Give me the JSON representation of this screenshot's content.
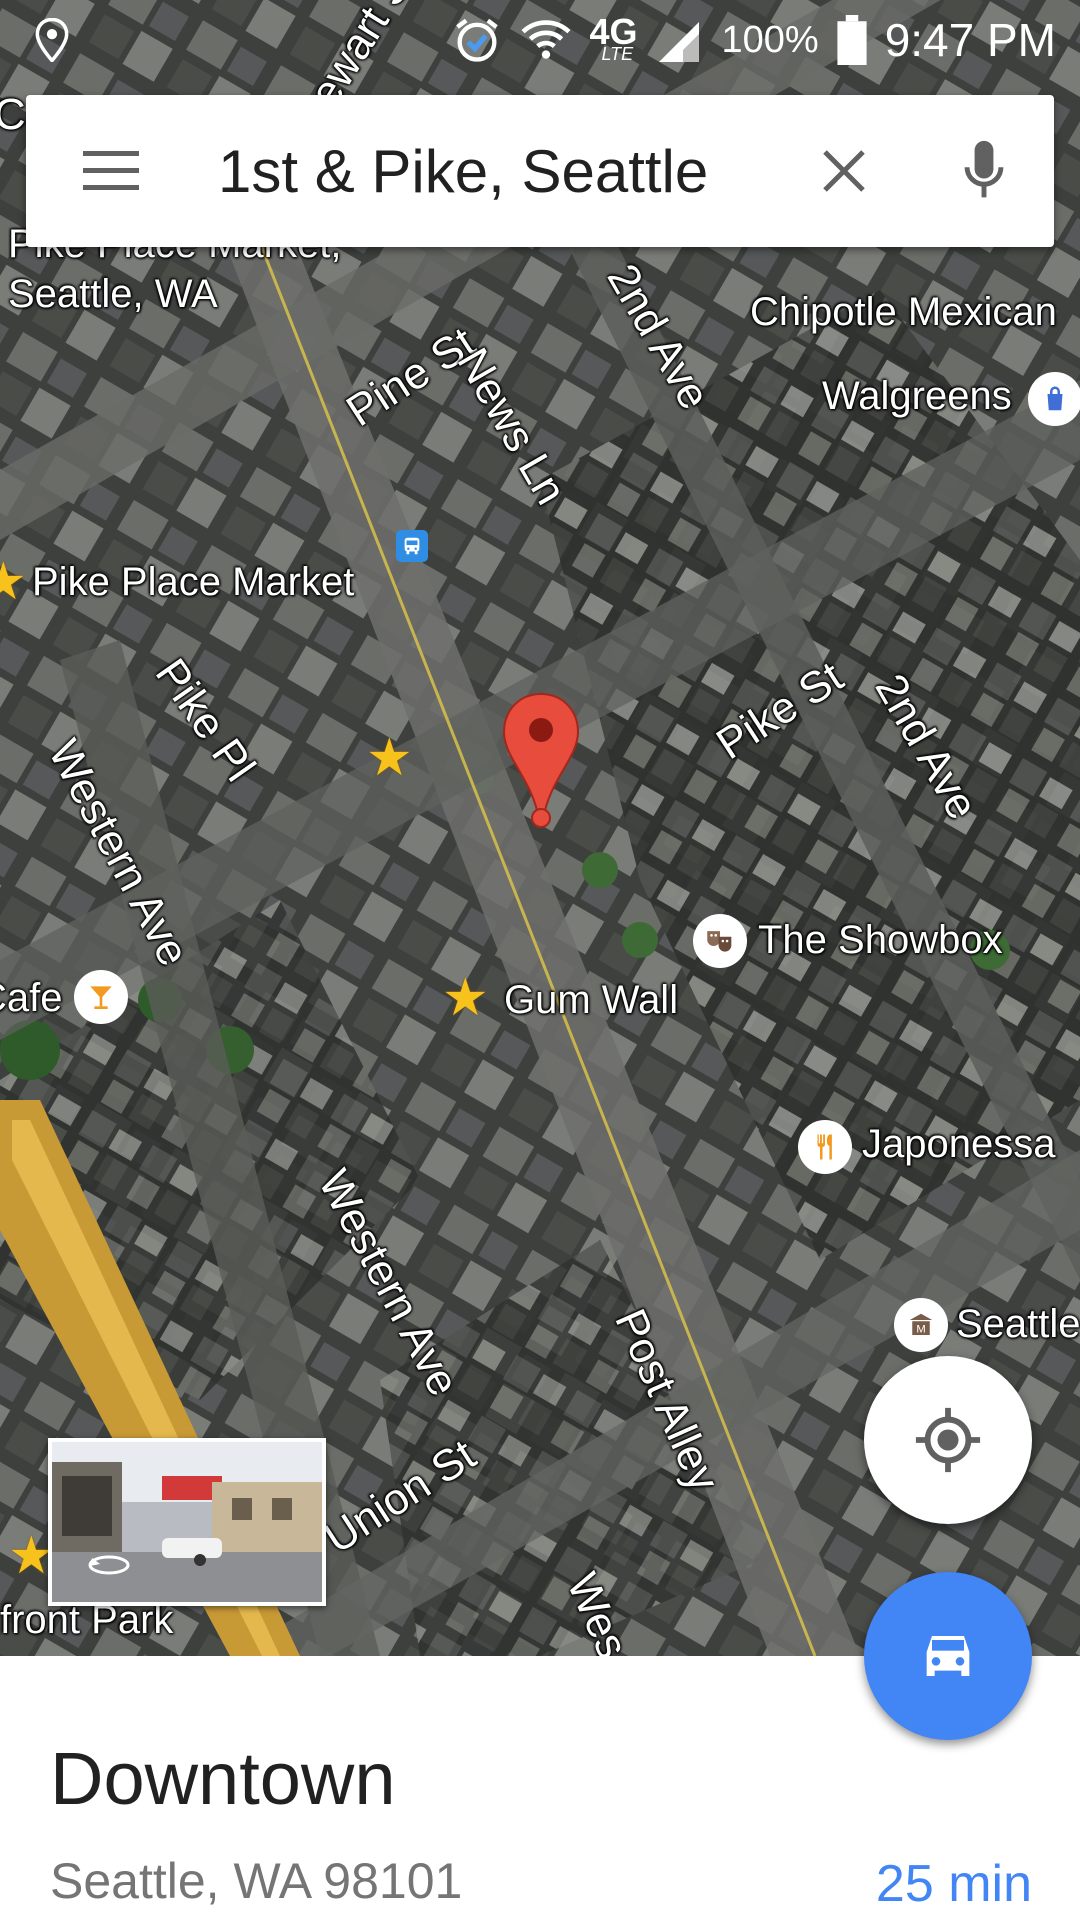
{
  "status_bar": {
    "battery": "100%",
    "time": "9:47 PM",
    "network": "4G",
    "network_sub": "LTE",
    "icons": [
      "location-icon",
      "alarm-icon",
      "wifi-icon",
      "signal-icon",
      "battery-icon"
    ]
  },
  "search": {
    "query": "1st & Pike, Seattle",
    "menu_icon": "hamburger-menu-icon",
    "clear_icon": "close-icon",
    "voice_icon": "microphone-icon"
  },
  "map": {
    "view": "satellite",
    "streets": {
      "pine": "Pine St",
      "news": "News Ln",
      "second_ave_top": "2nd Ave",
      "pike_st": "Pike St",
      "second_ave_right": "2nd Ave",
      "pike_pl": "Pike Pl",
      "western_ave_left": "Western Ave",
      "western_ave_mid": "Western Ave",
      "post_alley": "Post Alley",
      "union_st": "Union St",
      "west_bottom": "Wes",
      "partial_top": "ewart S",
      "partial_ca": "Ca",
      "partial_st": "St"
    },
    "places": {
      "pike_place_market_area": "Pike Place Market,",
      "pike_place_market_area_sub": "Seattle, WA",
      "chipotle": "Chipotle Mexican",
      "walgreens": "Walgreens",
      "pike_place_market": "Pike Place Market",
      "showbox": "The Showbox",
      "gum_wall": "Gum Wall",
      "cafe": "Cafe",
      "japonessa": "Japonessa",
      "seattle_partial": "Seattle",
      "waterfront_park": "front Park"
    },
    "pin_color": "#ea4335"
  },
  "streetview_thumbnail": {
    "icon": "360-rotate-icon"
  },
  "buttons": {
    "my_location_icon": "my-location-icon",
    "directions_icon": "car-icon"
  },
  "place": {
    "title": "Downtown",
    "address": "Seattle, WA 98101",
    "eta": "25 min"
  },
  "colors": {
    "accent": "#4285f4",
    "text_primary": "#212121",
    "text_secondary": "#757575"
  }
}
